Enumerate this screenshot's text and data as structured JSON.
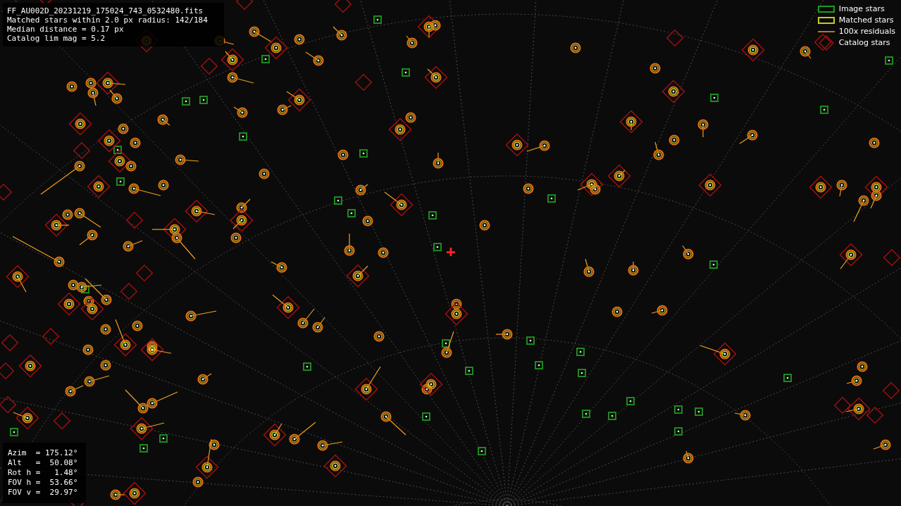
{
  "info": {
    "lines": [
      "FF_AU002D_20231219_175024_743_0532480.fits",
      "Matched stars within 2.0 px radius: 142/184",
      "Median distance = 0.17 px",
      "Catalog lim mag = 5.2"
    ]
  },
  "legend": [
    {
      "kind": "image",
      "label": "Image stars"
    },
    {
      "kind": "matched",
      "label": "Matched stars"
    },
    {
      "kind": "residual",
      "label": "100x residuals"
    },
    {
      "kind": "catalog",
      "label": "Catalog stars"
    }
  ],
  "pointing": {
    "lines": [
      "Azim  = 175.12°",
      "Alt   =  50.08°",
      "Rot h =   1.48°",
      "FOV h =  53.66°",
      "FOV v =  29.97°"
    ]
  }
}
